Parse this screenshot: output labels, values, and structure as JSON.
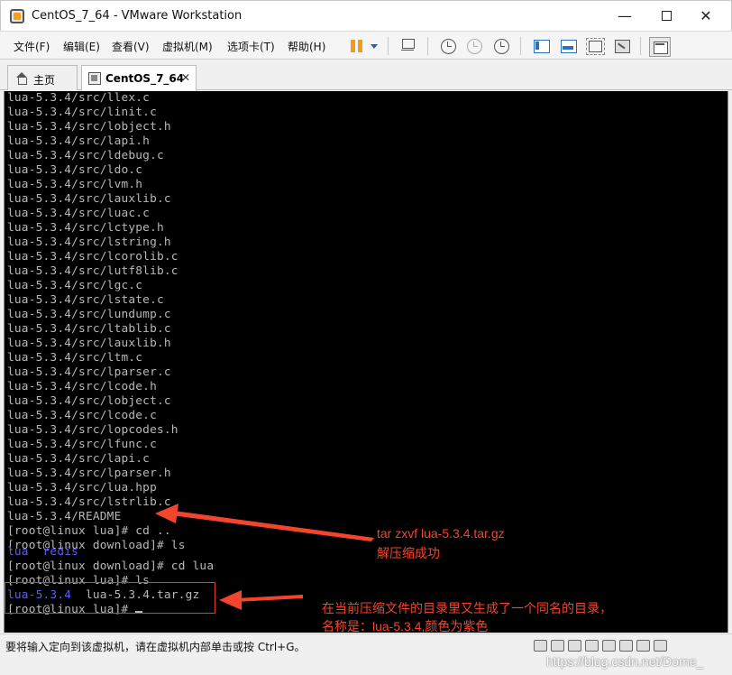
{
  "window": {
    "title": "CentOS_7_64 - VMware Workstation",
    "minimize": "—",
    "close": "✕"
  },
  "menu": {
    "file": "文件(F)",
    "edit": "编辑(E)",
    "view": "查看(V)",
    "vm": "虚拟机(M)",
    "tabs": "选项卡(T)",
    "help": "帮助(H)"
  },
  "toolbar_icons": [
    "pause-icon",
    "dropdown-icon",
    "network-icon",
    "snapshot-icon",
    "revert-snapshot-icon",
    "snapshot-manager-icon",
    "console-view-icon",
    "thumbnail-view-icon",
    "fullscreen-icon",
    "unity-icon",
    "library-icon"
  ],
  "tabs": [
    {
      "label": "主页"
    },
    {
      "label": "CentOS_7_64",
      "close": "✕",
      "active": true
    }
  ],
  "terminal": {
    "lines": [
      "lua-5.3.4/src/llex.c",
      "lua-5.3.4/src/linit.c",
      "lua-5.3.4/src/lobject.h",
      "lua-5.3.4/src/lapi.h",
      "lua-5.3.4/src/ldebug.c",
      "lua-5.3.4/src/ldo.c",
      "lua-5.3.4/src/lvm.h",
      "lua-5.3.4/src/lauxlib.c",
      "lua-5.3.4/src/luac.c",
      "lua-5.3.4/src/lctype.h",
      "lua-5.3.4/src/lstring.h",
      "lua-5.3.4/src/lcorolib.c",
      "lua-5.3.4/src/lutf8lib.c",
      "lua-5.3.4/src/lgc.c",
      "lua-5.3.4/src/lstate.c",
      "lua-5.3.4/src/lundump.c",
      "lua-5.3.4/src/ltablib.c",
      "lua-5.3.4/src/lauxlib.h",
      "lua-5.3.4/src/ltm.c",
      "lua-5.3.4/src/lparser.c",
      "lua-5.3.4/src/lcode.h",
      "lua-5.3.4/src/lobject.c",
      "lua-5.3.4/src/lcode.c",
      "lua-5.3.4/src/lopcodes.h",
      "lua-5.3.4/src/lfunc.c",
      "lua-5.3.4/src/lapi.c",
      "lua-5.3.4/src/lparser.h",
      "lua-5.3.4/src/lua.hpp",
      "lua-5.3.4/src/lstrlib.c",
      "lua-5.3.4/README",
      "[root@linux lua]# cd ..",
      "[root@linux download]# ls"
    ],
    "ls1": {
      "a": "lua",
      "b": "redis"
    },
    "line_cd_lua": "[root@linux download]# cd lua",
    "line_ls": "[root@linux lua]# ls",
    "ls2": {
      "dir": "lua-5.3.4",
      "file": "lua-5.3.4.tar.gz"
    },
    "prompt": "[root@linux lua]# ",
    "colors": {
      "text": "#b8b8b8",
      "directory": "#5a5cff",
      "background": "#000000"
    }
  },
  "annotations": {
    "a1_line1": "tar zxvf lua-5.3.4.tar.gz",
    "a1_line2": "解压缩成功",
    "a2_line1": "在当前压缩文件的目录里又生成了一个同名的目录，",
    "a2_line2": "名称是：lua-5.3.4,颜色为紫色",
    "color": "#f2452c"
  },
  "status": {
    "text": "要将输入定向到该虚拟机，请在虚拟机内部单击或按 Ctrl+G。",
    "watermark": "https://blog.csdn.net/Dome_"
  }
}
